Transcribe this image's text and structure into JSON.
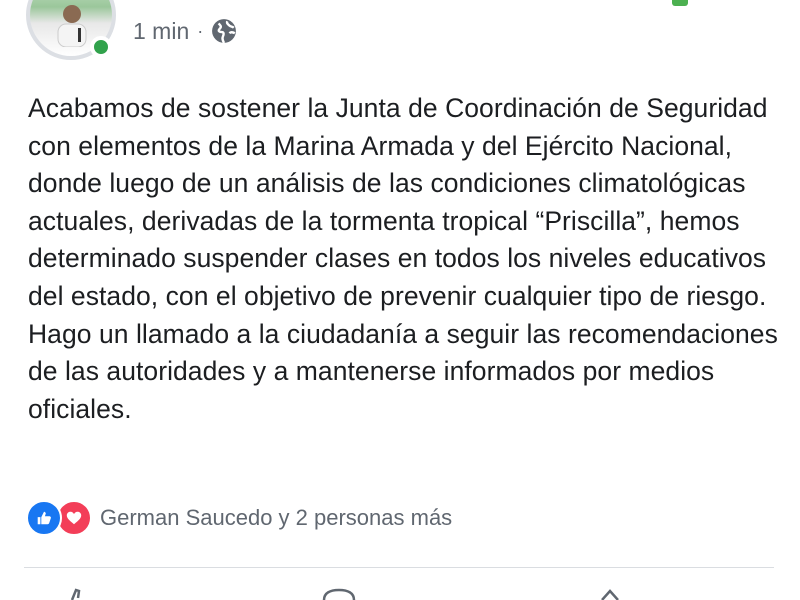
{
  "post": {
    "timestamp": "1 min",
    "separator": "·",
    "privacy_icon": "globe-icon",
    "text": "Acabamos de sostener la Junta de Coordinación de Seguridad con elementos de la Marina Armada y del Ejército Nacional, donde luego de un análisis de las condiciones climatológicas actuales, derivadas de la tormenta tropical “Priscilla”, hemos determinado suspender clases en todos los niveles educativos del estado, con el objetivo de prevenir cualquier tipo de riesgo. Hago un llamado a la ciudadanía a seguir las recomendaciones de las autoridades y a mantenerse informados por medios oficiales."
  },
  "reactions": {
    "icons": [
      "like-icon",
      "love-icon"
    ],
    "summary": "German Saucedo y 2 personas más"
  },
  "actions": {
    "icons": [
      "like-icon",
      "comment-icon",
      "share-icon"
    ]
  },
  "colors": {
    "like": "#1877f2",
    "love": "#f33e58",
    "online": "#31a24c",
    "meta_text": "#606770"
  }
}
